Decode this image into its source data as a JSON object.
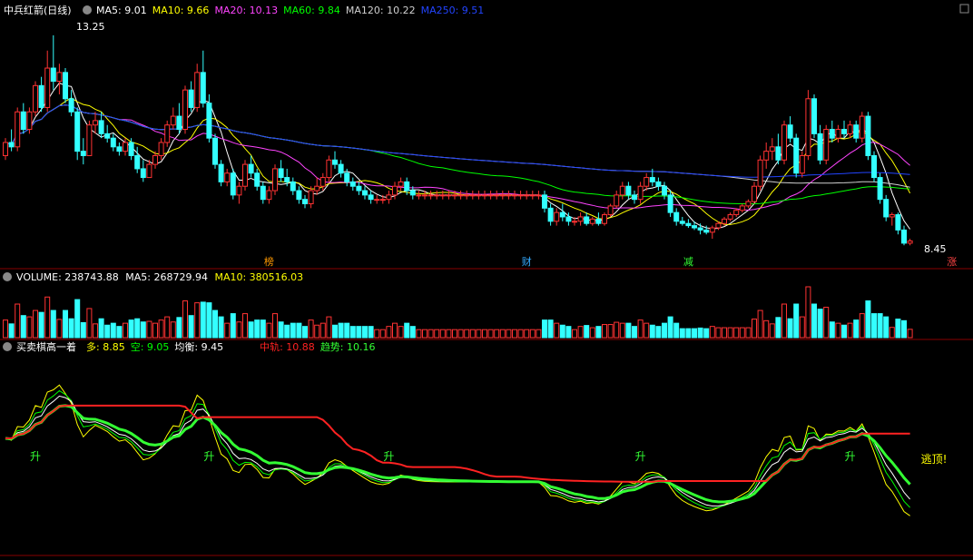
{
  "header": {
    "title": "中兵红箭(日线)",
    "indicators": [
      {
        "label": "MA5: 9.01",
        "color": "#ffffff"
      },
      {
        "label": "MA10: 9.66",
        "color": "#ffff00"
      },
      {
        "label": "MA20: 10.13",
        "color": "#ff44ff"
      },
      {
        "label": "MA60: 9.84",
        "color": "#00ff00"
      },
      {
        "label": "MA120: 10.22",
        "color": "#d0d0d0"
      },
      {
        "label": "MA250: 9.51",
        "color": "#2244ff"
      }
    ]
  },
  "price_markers": {
    "high": "13.25",
    "low": "8.45"
  },
  "event_tags": [
    {
      "label": "榜",
      "color": "#ff9900",
      "bar": 44
    },
    {
      "label": "财",
      "color": "#33aaff",
      "bar": 87
    },
    {
      "label": "减",
      "color": "#33ff33",
      "bar": 114
    },
    {
      "label": "涨",
      "color": "#ff4444",
      "bar": 158
    }
  ],
  "volume_header": {
    "label": "VOLUME: 238743.88",
    "ma5": "MA5: 268729.94",
    "ma10": "MA10: 380516.03"
  },
  "indicator_header": {
    "name": "买卖棋高一着",
    "items": [
      {
        "label": "多: 8.85",
        "color": "#ffff00"
      },
      {
        "label": "空: 9.05",
        "color": "#00ff00"
      },
      {
        "label": "均衡: 9.45",
        "color": "#ffffff"
      },
      {
        "label": "中轨: 10.88",
        "color": "#ff2222"
      },
      {
        "label": "趋势: 10.16",
        "color": "#33ff33"
      }
    ]
  },
  "signals": [
    {
      "label": "升",
      "bar": 5
    },
    {
      "label": "升",
      "bar": 34
    },
    {
      "label": "升",
      "bar": 64
    },
    {
      "label": "升",
      "bar": 106
    },
    {
      "label": "升",
      "bar": 141
    },
    {
      "label": "逃顶!",
      "bar": 155
    }
  ],
  "colors": {
    "up": "#ff3333",
    "down": "#33ffff",
    "axis": "#880000"
  },
  "chart_data": [
    {
      "type": "candlestick",
      "ylim": [
        8.0,
        13.6
      ],
      "candles": [
        {
          "o": 10.5,
          "h": 10.9,
          "l": 10.4,
          "c": 10.8
        },
        {
          "o": 10.8,
          "h": 11.1,
          "l": 10.6,
          "c": 10.7
        },
        {
          "o": 10.7,
          "h": 11.6,
          "l": 10.6,
          "c": 11.5
        },
        {
          "o": 11.5,
          "h": 11.7,
          "l": 11.0,
          "c": 11.1
        },
        {
          "o": 11.1,
          "h": 11.6,
          "l": 11.0,
          "c": 11.5
        },
        {
          "o": 11.5,
          "h": 12.2,
          "l": 11.4,
          "c": 12.1
        },
        {
          "o": 12.1,
          "h": 12.3,
          "l": 11.5,
          "c": 11.6
        },
        {
          "o": 11.6,
          "h": 12.9,
          "l": 11.5,
          "c": 12.5
        },
        {
          "o": 12.5,
          "h": 13.25,
          "l": 12.0,
          "c": 12.2
        },
        {
          "o": 12.2,
          "h": 12.6,
          "l": 11.9,
          "c": 12.4
        },
        {
          "o": 12.4,
          "h": 12.5,
          "l": 11.7,
          "c": 11.8
        },
        {
          "o": 11.8,
          "h": 12.0,
          "l": 11.4,
          "c": 11.5
        },
        {
          "o": 11.5,
          "h": 11.6,
          "l": 10.4,
          "c": 10.6
        },
        {
          "o": 10.6,
          "h": 10.9,
          "l": 10.3,
          "c": 10.5
        },
        {
          "o": 10.5,
          "h": 11.3,
          "l": 10.5,
          "c": 11.2
        },
        {
          "o": 11.2,
          "h": 11.5,
          "l": 11.0,
          "c": 11.3
        },
        {
          "o": 11.3,
          "h": 11.5,
          "l": 10.9,
          "c": 11.0
        },
        {
          "o": 11.0,
          "h": 11.2,
          "l": 10.8,
          "c": 10.9
        },
        {
          "o": 10.9,
          "h": 11.0,
          "l": 10.6,
          "c": 10.7
        },
        {
          "o": 10.7,
          "h": 10.8,
          "l": 10.5,
          "c": 10.6
        },
        {
          "o": 10.6,
          "h": 10.9,
          "l": 10.5,
          "c": 10.8
        },
        {
          "o": 10.8,
          "h": 10.9,
          "l": 10.4,
          "c": 10.5
        },
        {
          "o": 10.5,
          "h": 10.7,
          "l": 10.1,
          "c": 10.2
        },
        {
          "o": 10.2,
          "h": 10.4,
          "l": 9.9,
          "c": 10.0
        },
        {
          "o": 10.0,
          "h": 10.4,
          "l": 10.0,
          "c": 10.3
        },
        {
          "o": 10.3,
          "h": 10.6,
          "l": 10.2,
          "c": 10.5
        },
        {
          "o": 10.5,
          "h": 10.9,
          "l": 10.4,
          "c": 10.8
        },
        {
          "o": 10.8,
          "h": 11.3,
          "l": 10.7,
          "c": 11.2
        },
        {
          "o": 11.2,
          "h": 11.6,
          "l": 11.1,
          "c": 11.4
        },
        {
          "o": 11.4,
          "h": 11.7,
          "l": 11.0,
          "c": 11.1
        },
        {
          "o": 11.1,
          "h": 12.1,
          "l": 11.0,
          "c": 12.0
        },
        {
          "o": 12.0,
          "h": 12.2,
          "l": 11.5,
          "c": 11.6
        },
        {
          "o": 11.6,
          "h": 12.6,
          "l": 11.5,
          "c": 12.4
        },
        {
          "o": 12.4,
          "h": 12.9,
          "l": 11.6,
          "c": 11.7
        },
        {
          "o": 11.7,
          "h": 11.9,
          "l": 10.8,
          "c": 10.9
        },
        {
          "o": 10.9,
          "h": 11.0,
          "l": 10.2,
          "c": 10.3
        },
        {
          "o": 10.3,
          "h": 10.4,
          "l": 9.8,
          "c": 9.9
        },
        {
          "o": 9.9,
          "h": 10.2,
          "l": 9.8,
          "c": 10.1
        },
        {
          "o": 10.1,
          "h": 10.2,
          "l": 9.5,
          "c": 9.6
        },
        {
          "o": 9.6,
          "h": 9.9,
          "l": 9.4,
          "c": 9.8
        },
        {
          "o": 9.8,
          "h": 10.4,
          "l": 9.7,
          "c": 10.3
        },
        {
          "o": 10.3,
          "h": 10.5,
          "l": 10.0,
          "c": 10.1
        },
        {
          "o": 10.1,
          "h": 10.2,
          "l": 9.7,
          "c": 9.8
        },
        {
          "o": 9.8,
          "h": 9.9,
          "l": 9.4,
          "c": 9.5
        },
        {
          "o": 9.5,
          "h": 9.8,
          "l": 9.4,
          "c": 9.7
        },
        {
          "o": 9.7,
          "h": 10.3,
          "l": 9.6,
          "c": 10.2
        },
        {
          "o": 10.2,
          "h": 10.4,
          "l": 9.9,
          "c": 10.0
        },
        {
          "o": 10.0,
          "h": 10.2,
          "l": 9.8,
          "c": 9.9
        },
        {
          "o": 9.9,
          "h": 10.0,
          "l": 9.6,
          "c": 9.7
        },
        {
          "o": 9.7,
          "h": 9.8,
          "l": 9.4,
          "c": 9.5
        },
        {
          "o": 9.5,
          "h": 9.6,
          "l": 9.3,
          "c": 9.4
        },
        {
          "o": 9.4,
          "h": 9.8,
          "l": 9.3,
          "c": 9.7
        },
        {
          "o": 9.7,
          "h": 10.0,
          "l": 9.6,
          "c": 9.8
        },
        {
          "o": 9.8,
          "h": 10.1,
          "l": 9.7,
          "c": 10.0
        },
        {
          "o": 10.0,
          "h": 10.5,
          "l": 9.9,
          "c": 10.4
        },
        {
          "o": 10.4,
          "h": 10.6,
          "l": 10.2,
          "c": 10.3
        },
        {
          "o": 10.3,
          "h": 10.4,
          "l": 10.0,
          "c": 10.1
        },
        {
          "o": 10.1,
          "h": 10.2,
          "l": 9.8,
          "c": 9.9
        },
        {
          "o": 9.9,
          "h": 10.0,
          "l": 9.7,
          "c": 9.8
        },
        {
          "o": 9.8,
          "h": 9.9,
          "l": 9.6,
          "c": 9.7
        },
        {
          "o": 9.7,
          "h": 9.8,
          "l": 9.5,
          "c": 9.6
        },
        {
          "o": 9.6,
          "h": 9.7,
          "l": 9.4,
          "c": 9.5
        },
        {
          "o": 9.5,
          "h": 9.6,
          "l": 9.4,
          "c": 9.5
        },
        {
          "o": 9.5,
          "h": 9.6,
          "l": 9.4,
          "c": 9.5
        },
        {
          "o": 9.5,
          "h": 9.7,
          "l": 9.4,
          "c": 9.6
        },
        {
          "o": 9.6,
          "h": 9.9,
          "l": 9.5,
          "c": 9.8
        },
        {
          "o": 9.8,
          "h": 10.0,
          "l": 9.7,
          "c": 9.9
        },
        {
          "o": 9.9,
          "h": 10.0,
          "l": 9.6,
          "c": 9.7
        },
        {
          "o": 9.7,
          "h": 9.8,
          "l": 9.5,
          "c": 9.6
        },
        {
          "o": 9.6,
          "h": 9.7,
          "l": 9.5,
          "c": 9.6
        },
        {
          "o": 9.6,
          "h": 9.7,
          "l": 9.5,
          "c": 9.6
        },
        {
          "o": 9.6,
          "h": 9.7,
          "l": 9.5,
          "c": 9.6
        },
        {
          "o": 9.6,
          "h": 9.7,
          "l": 9.5,
          "c": 9.6
        },
        {
          "o": 9.6,
          "h": 9.7,
          "l": 9.5,
          "c": 9.6
        },
        {
          "o": 9.6,
          "h": 9.7,
          "l": 9.5,
          "c": 9.6
        },
        {
          "o": 9.6,
          "h": 9.7,
          "l": 9.5,
          "c": 9.6
        },
        {
          "o": 9.6,
          "h": 9.7,
          "l": 9.5,
          "c": 9.6
        },
        {
          "o": 9.6,
          "h": 9.7,
          "l": 9.5,
          "c": 9.6
        },
        {
          "o": 9.6,
          "h": 9.7,
          "l": 9.5,
          "c": 9.6
        },
        {
          "o": 9.6,
          "h": 9.7,
          "l": 9.5,
          "c": 9.6
        },
        {
          "o": 9.6,
          "h": 9.7,
          "l": 9.5,
          "c": 9.6
        },
        {
          "o": 9.6,
          "h": 9.7,
          "l": 9.5,
          "c": 9.6
        },
        {
          "o": 9.6,
          "h": 9.7,
          "l": 9.5,
          "c": 9.6
        },
        {
          "o": 9.6,
          "h": 9.7,
          "l": 9.5,
          "c": 9.6
        },
        {
          "o": 9.6,
          "h": 9.7,
          "l": 9.5,
          "c": 9.6
        },
        {
          "o": 9.6,
          "h": 9.7,
          "l": 9.5,
          "c": 9.6
        },
        {
          "o": 9.6,
          "h": 9.7,
          "l": 9.5,
          "c": 9.6
        },
        {
          "o": 9.6,
          "h": 9.7,
          "l": 9.5,
          "c": 9.6
        },
        {
          "o": 9.6,
          "h": 9.7,
          "l": 9.5,
          "c": 9.6
        },
        {
          "o": 9.6,
          "h": 9.7,
          "l": 9.5,
          "c": 9.6
        },
        {
          "o": 9.6,
          "h": 9.7,
          "l": 9.2,
          "c": 9.3
        },
        {
          "o": 9.3,
          "h": 9.4,
          "l": 8.9,
          "c": 9.0
        },
        {
          "o": 9.0,
          "h": 9.3,
          "l": 8.9,
          "c": 9.2
        },
        {
          "o": 9.2,
          "h": 9.4,
          "l": 9.0,
          "c": 9.1
        },
        {
          "o": 9.1,
          "h": 9.2,
          "l": 8.9,
          "c": 9.0
        },
        {
          "o": 9.0,
          "h": 9.1,
          "l": 8.9,
          "c": 9.0
        },
        {
          "o": 9.0,
          "h": 9.2,
          "l": 8.9,
          "c": 9.1
        },
        {
          "o": 9.1,
          "h": 9.2,
          "l": 8.9,
          "c": 8.95
        },
        {
          "o": 8.95,
          "h": 9.1,
          "l": 8.9,
          "c": 9.05
        },
        {
          "o": 9.05,
          "h": 9.2,
          "l": 8.9,
          "c": 8.95
        },
        {
          "o": 8.95,
          "h": 9.2,
          "l": 8.9,
          "c": 9.15
        },
        {
          "o": 9.15,
          "h": 9.4,
          "l": 9.1,
          "c": 9.35
        },
        {
          "o": 9.35,
          "h": 9.7,
          "l": 9.3,
          "c": 9.6
        },
        {
          "o": 9.6,
          "h": 9.9,
          "l": 9.5,
          "c": 9.8
        },
        {
          "o": 9.8,
          "h": 9.9,
          "l": 9.5,
          "c": 9.6
        },
        {
          "o": 9.6,
          "h": 9.7,
          "l": 9.4,
          "c": 9.5
        },
        {
          "o": 9.5,
          "h": 9.9,
          "l": 9.4,
          "c": 9.8
        },
        {
          "o": 9.8,
          "h": 10.1,
          "l": 9.7,
          "c": 10.0
        },
        {
          "o": 10.0,
          "h": 10.2,
          "l": 9.8,
          "c": 9.9
        },
        {
          "o": 9.9,
          "h": 10.0,
          "l": 9.7,
          "c": 9.8
        },
        {
          "o": 9.8,
          "h": 9.9,
          "l": 9.5,
          "c": 9.6
        },
        {
          "o": 9.6,
          "h": 9.7,
          "l": 9.1,
          "c": 9.2
        },
        {
          "o": 9.2,
          "h": 9.3,
          "l": 8.9,
          "c": 9.0
        },
        {
          "o": 9.0,
          "h": 9.1,
          "l": 8.9,
          "c": 8.95
        },
        {
          "o": 8.95,
          "h": 9.05,
          "l": 8.85,
          "c": 8.9
        },
        {
          "o": 8.9,
          "h": 9.0,
          "l": 8.8,
          "c": 8.85
        },
        {
          "o": 8.85,
          "h": 8.95,
          "l": 8.7,
          "c": 8.8
        },
        {
          "o": 8.8,
          "h": 8.9,
          "l": 8.7,
          "c": 8.75
        },
        {
          "o": 8.75,
          "h": 8.9,
          "l": 8.6,
          "c": 8.85
        },
        {
          "o": 8.85,
          "h": 9.0,
          "l": 8.8,
          "c": 8.95
        },
        {
          "o": 8.95,
          "h": 9.1,
          "l": 8.9,
          "c": 9.05
        },
        {
          "o": 9.05,
          "h": 9.2,
          "l": 9.0,
          "c": 9.15
        },
        {
          "o": 9.15,
          "h": 9.3,
          "l": 9.1,
          "c": 9.25
        },
        {
          "o": 9.25,
          "h": 9.4,
          "l": 9.2,
          "c": 9.35
        },
        {
          "o": 9.35,
          "h": 9.5,
          "l": 9.3,
          "c": 9.45
        },
        {
          "o": 9.45,
          "h": 9.9,
          "l": 9.4,
          "c": 9.8
        },
        {
          "o": 9.8,
          "h": 10.5,
          "l": 9.7,
          "c": 10.4
        },
        {
          "o": 10.4,
          "h": 10.8,
          "l": 10.2,
          "c": 10.6
        },
        {
          "o": 10.6,
          "h": 10.9,
          "l": 10.4,
          "c": 10.7
        },
        {
          "o": 10.7,
          "h": 11.0,
          "l": 10.3,
          "c": 10.4
        },
        {
          "o": 10.4,
          "h": 11.3,
          "l": 10.3,
          "c": 11.2
        },
        {
          "o": 11.2,
          "h": 11.4,
          "l": 10.8,
          "c": 10.9
        },
        {
          "o": 10.9,
          "h": 11.0,
          "l": 10.0,
          "c": 10.1
        },
        {
          "o": 10.1,
          "h": 10.6,
          "l": 10.0,
          "c": 10.5
        },
        {
          "o": 10.5,
          "h": 12.0,
          "l": 10.4,
          "c": 11.8
        },
        {
          "o": 11.8,
          "h": 11.9,
          "l": 10.9,
          "c": 11.0
        },
        {
          "o": 11.0,
          "h": 11.2,
          "l": 10.3,
          "c": 10.4
        },
        {
          "o": 10.4,
          "h": 11.2,
          "l": 10.3,
          "c": 11.1
        },
        {
          "o": 11.1,
          "h": 11.3,
          "l": 10.8,
          "c": 10.9
        },
        {
          "o": 10.9,
          "h": 11.2,
          "l": 10.8,
          "c": 11.1
        },
        {
          "o": 11.1,
          "h": 11.3,
          "l": 10.9,
          "c": 11.0
        },
        {
          "o": 11.0,
          "h": 11.3,
          "l": 10.9,
          "c": 11.2
        },
        {
          "o": 11.2,
          "h": 11.3,
          "l": 10.8,
          "c": 10.9
        },
        {
          "o": 10.9,
          "h": 11.5,
          "l": 10.8,
          "c": 11.4
        },
        {
          "o": 11.4,
          "h": 11.5,
          "l": 10.4,
          "c": 10.5
        },
        {
          "o": 10.5,
          "h": 10.6,
          "l": 9.9,
          "c": 10.0
        },
        {
          "o": 10.0,
          "h": 10.1,
          "l": 9.4,
          "c": 9.5
        },
        {
          "o": 9.5,
          "h": 9.6,
          "l": 9.0,
          "c": 9.1
        },
        {
          "o": 9.1,
          "h": 9.2,
          "l": 8.9,
          "c": 9.15
        },
        {
          "o": 9.15,
          "h": 9.2,
          "l": 8.7,
          "c": 8.8
        },
        {
          "o": 8.8,
          "h": 8.9,
          "l": 8.45,
          "c": 8.5
        },
        {
          "o": 8.5,
          "h": 8.6,
          "l": 8.45,
          "c": 8.55
        }
      ],
      "moving_averages": {
        "MA5": 9.01,
        "MA10": 9.66,
        "MA20": 10.13,
        "MA60": 9.84,
        "MA120": 10.22,
        "MA250": 9.51
      }
    },
    {
      "type": "bar",
      "title": "VOLUME",
      "values": [
        238743.88
      ],
      "ma5": 268729.94,
      "ma10": 380516.03
    },
    {
      "type": "line",
      "title": "买卖棋高一着",
      "series": [
        {
          "name": "多",
          "last": 8.85
        },
        {
          "name": "空",
          "last": 9.05
        },
        {
          "name": "均衡",
          "last": 9.45
        },
        {
          "name": "中轨",
          "last": 10.88
        },
        {
          "name": "趋势",
          "last": 10.16
        }
      ]
    }
  ]
}
